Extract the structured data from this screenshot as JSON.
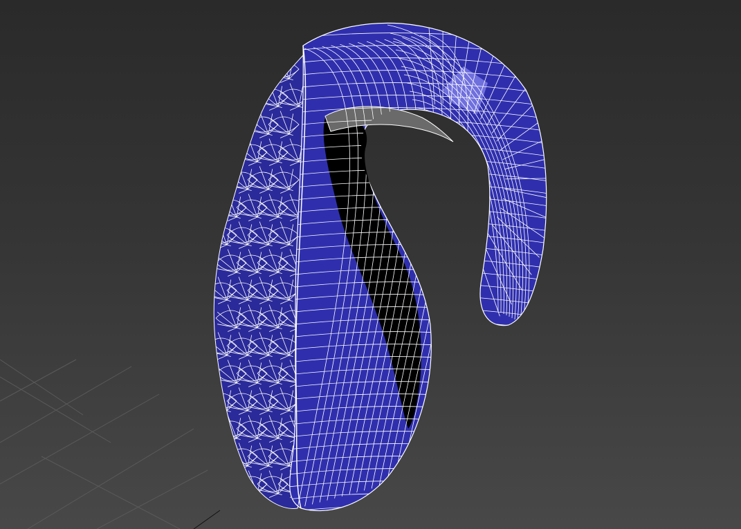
{
  "viewport": {
    "background_top": "#2a2a2a",
    "background_bottom": "#484848",
    "shading_mode": "wireframe-over-shaded"
  },
  "scene": {
    "object": {
      "icon": "hook-mesh-icon",
      "material_color": "#2f2fae",
      "highlight_color": "#7a7ae6",
      "shadow_color": "#000000",
      "wire_color": "#ffffff"
    },
    "grid": {
      "color": "#5a5a5a",
      "visible": true
    }
  }
}
